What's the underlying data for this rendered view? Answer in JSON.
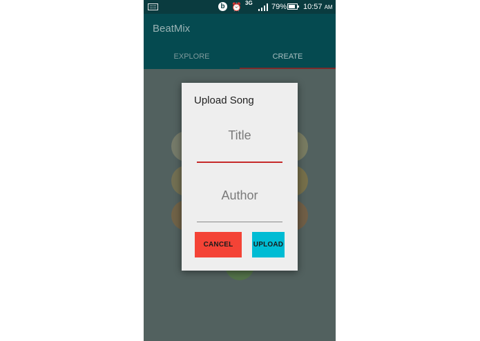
{
  "status_bar": {
    "network": "3G",
    "battery_percent": "79%",
    "time": "10:57",
    "time_suffix": "AM",
    "beats_glyph": "b"
  },
  "app": {
    "title": "BeatMix",
    "tabs": [
      {
        "label": "EXPLORE",
        "selected": false
      },
      {
        "label": "CREATE",
        "selected": true
      }
    ]
  },
  "dialog": {
    "title": "Upload Song",
    "title_field": {
      "placeholder": "Title",
      "value": ""
    },
    "author_field": {
      "placeholder": "Author",
      "value": ""
    },
    "cancel_label": "CANCEL",
    "upload_label": "UPLOAD"
  },
  "colors": {
    "status_bar": "#0a3b3f",
    "app_bar": "#054a50",
    "cancel_button": "#f44336",
    "upload_button": "#00bcd4",
    "focused_underline": "#c62828"
  },
  "icons": [
    "keyboard-icon",
    "beats-icon",
    "alarm-icon",
    "signal-icon",
    "battery-icon"
  ]
}
